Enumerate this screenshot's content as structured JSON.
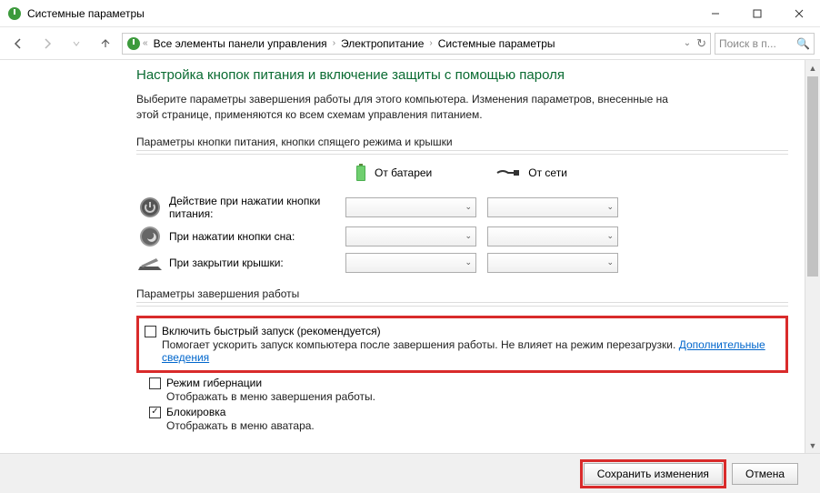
{
  "window": {
    "title": "Системные параметры"
  },
  "breadcrumb": {
    "items": [
      "Все элементы панели управления",
      "Электропитание",
      "Системные параметры"
    ]
  },
  "search": {
    "placeholder": "Поиск в п..."
  },
  "page": {
    "heading": "Настройка кнопок питания и включение защиты с помощью пароля",
    "intro": "Выберите параметры завершения работы для этого компьютера. Изменения параметров, внесенные на этой странице, применяются ко всем схемам управления питанием.",
    "section_buttons": "Параметры кнопки питания, кнопки спящего режима и крышки",
    "col_battery": "От батареи",
    "col_ac": "От сети",
    "rows": {
      "power_button": "Действие при нажатии кнопки питания:",
      "sleep_button": "При нажатии кнопки сна:",
      "lid_close": "При закрытии крышки:"
    },
    "section_shutdown": "Параметры завершения работы",
    "fast_startup": {
      "title": "Включить быстрый запуск (рекомендуется)",
      "desc_prefix": "Помогает ускорить запуск компьютера после завершения работы. Не влияет на режим перезагрузки. ",
      "link": "Дополнительные сведения"
    },
    "hibernate": {
      "title": "Режим гибернации",
      "desc": "Отображать в меню завершения работы."
    },
    "lock": {
      "title": "Блокировка",
      "desc": "Отображать в меню аватара."
    }
  },
  "footer": {
    "save": "Сохранить изменения",
    "cancel": "Отмена"
  }
}
